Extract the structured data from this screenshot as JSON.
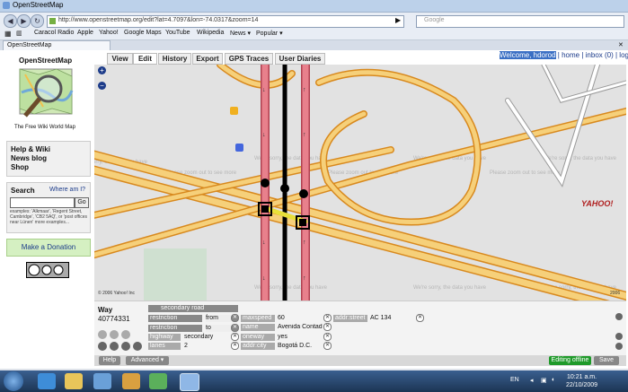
{
  "window": {
    "title": "OpenStreetMap"
  },
  "nav": {
    "url": "http://www.openstreetmap.org/edit?lat=4.7097&lon=-74.0317&zoom=14",
    "search_placeholder": "Google"
  },
  "bookmarks": [
    "Caracol Radio",
    "Apple",
    "Yahoo!",
    "Google Maps",
    "YouTube",
    "Wikipedia",
    "News ▾",
    "Popular ▾"
  ],
  "tab": {
    "label": "OpenStreetMap"
  },
  "osm_tabs": [
    "View",
    "Edit",
    "History",
    "Export",
    "GPS Traces",
    "User Diaries"
  ],
  "user": {
    "welcome": "Welcome, hdorod",
    "home": "home",
    "inbox": "inbox (0)",
    "logout": "logout"
  },
  "left": {
    "logo_title": "OpenStreetMap",
    "logo_caption": "The Free Wiki World Map",
    "links": [
      "Help & Wiki",
      "News blog",
      "Shop"
    ],
    "search_label": "Search",
    "where_am_i": "Where am I?",
    "go_label": "Go",
    "examples_text": "examples: 'Alkmaar', 'Regent Street, Cambridge', 'CB2 5AQ', or 'post offices near Lünen' more examples...",
    "donation": "Make a Donation"
  },
  "map": {
    "tile_notice": "We're sorry, the data you have requested is unavailable.",
    "tile_hint": "Please zoom out to see more map information or refresh your browser to try again.",
    "copyright": "© 2006 Yahoo! Inc",
    "yahoo": "YAHOO!",
    "year": "2006"
  },
  "editor": {
    "type_label": "Way",
    "way_id": "40774331",
    "preset": "secondary road",
    "tags": [
      {
        "k": "restriction",
        "v": "from"
      },
      {
        "k": "restriction",
        "v": "to"
      },
      {
        "k": "highway",
        "v": "secondary"
      },
      {
        "k": "lanes",
        "v": "2"
      }
    ],
    "tags2": [
      {
        "k": "maxspeed",
        "v": "60"
      },
      {
        "k": "name",
        "v": "Avenida Contador"
      },
      {
        "k": "oneway",
        "v": "yes"
      },
      {
        "k": "addr:city",
        "v": "Bogotá D.C."
      }
    ],
    "tags3": [
      {
        "k": "addr:street",
        "v": "AC 134"
      }
    ],
    "help": "Help",
    "advanced": "Advanced ▾",
    "editing_status": "Editing offline",
    "save": "Save"
  },
  "taskbar": {
    "lang": "EN",
    "time": "10:21 a.m.",
    "date": "22/10/2009"
  },
  "colors": {
    "road_casing": "#d8891e",
    "road_fill": "#f6d07a",
    "selected_way": "#e8808c",
    "map_bg": "#e2e2e2",
    "link_blue": "#1a3a8a"
  }
}
